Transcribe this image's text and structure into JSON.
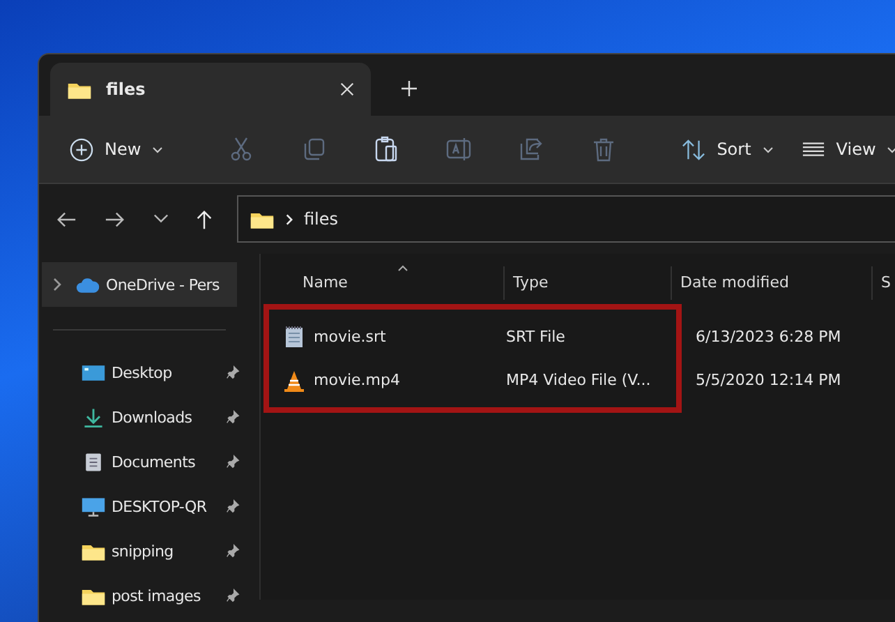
{
  "tabs": [
    {
      "title": "files",
      "selected": true
    }
  ],
  "toolbar": {
    "new_label": "New",
    "actions": [
      {
        "kind": "cut",
        "disabled": true
      },
      {
        "kind": "copy",
        "disabled": true
      },
      {
        "kind": "paste",
        "disabled": false
      },
      {
        "kind": "rename",
        "disabled": true
      },
      {
        "kind": "share",
        "disabled": true
      },
      {
        "kind": "delete",
        "disabled": true
      }
    ],
    "sort_label": "Sort",
    "view_label": "View"
  },
  "address": {
    "path": [
      "files"
    ]
  },
  "sidebar": {
    "top": {
      "label": "OneDrive - Pers",
      "kind": "cloud",
      "selected": true
    },
    "items": [
      {
        "label": "Desktop",
        "kind": "desktop",
        "pinned": true,
        "selected": false
      },
      {
        "label": "Downloads",
        "kind": "download",
        "pinned": true,
        "selected": false
      },
      {
        "label": "Documents",
        "kind": "document",
        "pinned": true,
        "selected": false
      },
      {
        "label": "DESKTOP-QR",
        "kind": "pc",
        "pinned": true,
        "selected": false
      },
      {
        "label": "snipping",
        "kind": "folder",
        "pinned": true,
        "selected": false
      },
      {
        "label": "post images",
        "kind": "folder",
        "pinned": true,
        "selected": false
      }
    ]
  },
  "table": {
    "columns": [
      "Name",
      "Type",
      "Date modified",
      "S"
    ],
    "rows": [
      {
        "name": "movie.srt",
        "kind": "text",
        "type": "SRT File",
        "date": "6/13/2023 6:28 PM"
      },
      {
        "name": "movie.mp4",
        "kind": "video",
        "type": "MP4 Video File (V...",
        "date": "5/5/2020 12:14 PM"
      }
    ],
    "highlighted": true
  }
}
